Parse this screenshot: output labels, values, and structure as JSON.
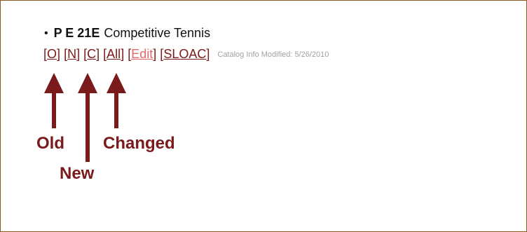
{
  "course": {
    "bullet": "•",
    "code": "P E 21E",
    "title": "Competitive Tennis"
  },
  "links": {
    "old": "O",
    "new": "N",
    "changed": "C",
    "all": "All",
    "edit": "Edit",
    "sloac": "SLOAC",
    "modified": "Catalog Info Modified: 5/26/2010"
  },
  "annotations": {
    "old": "Old",
    "new": "New",
    "changed": "Changed"
  },
  "colors": {
    "annotation": "#7a1a1a",
    "frame_border": "#8a5a1e",
    "edit_link": "#e06a6a"
  }
}
